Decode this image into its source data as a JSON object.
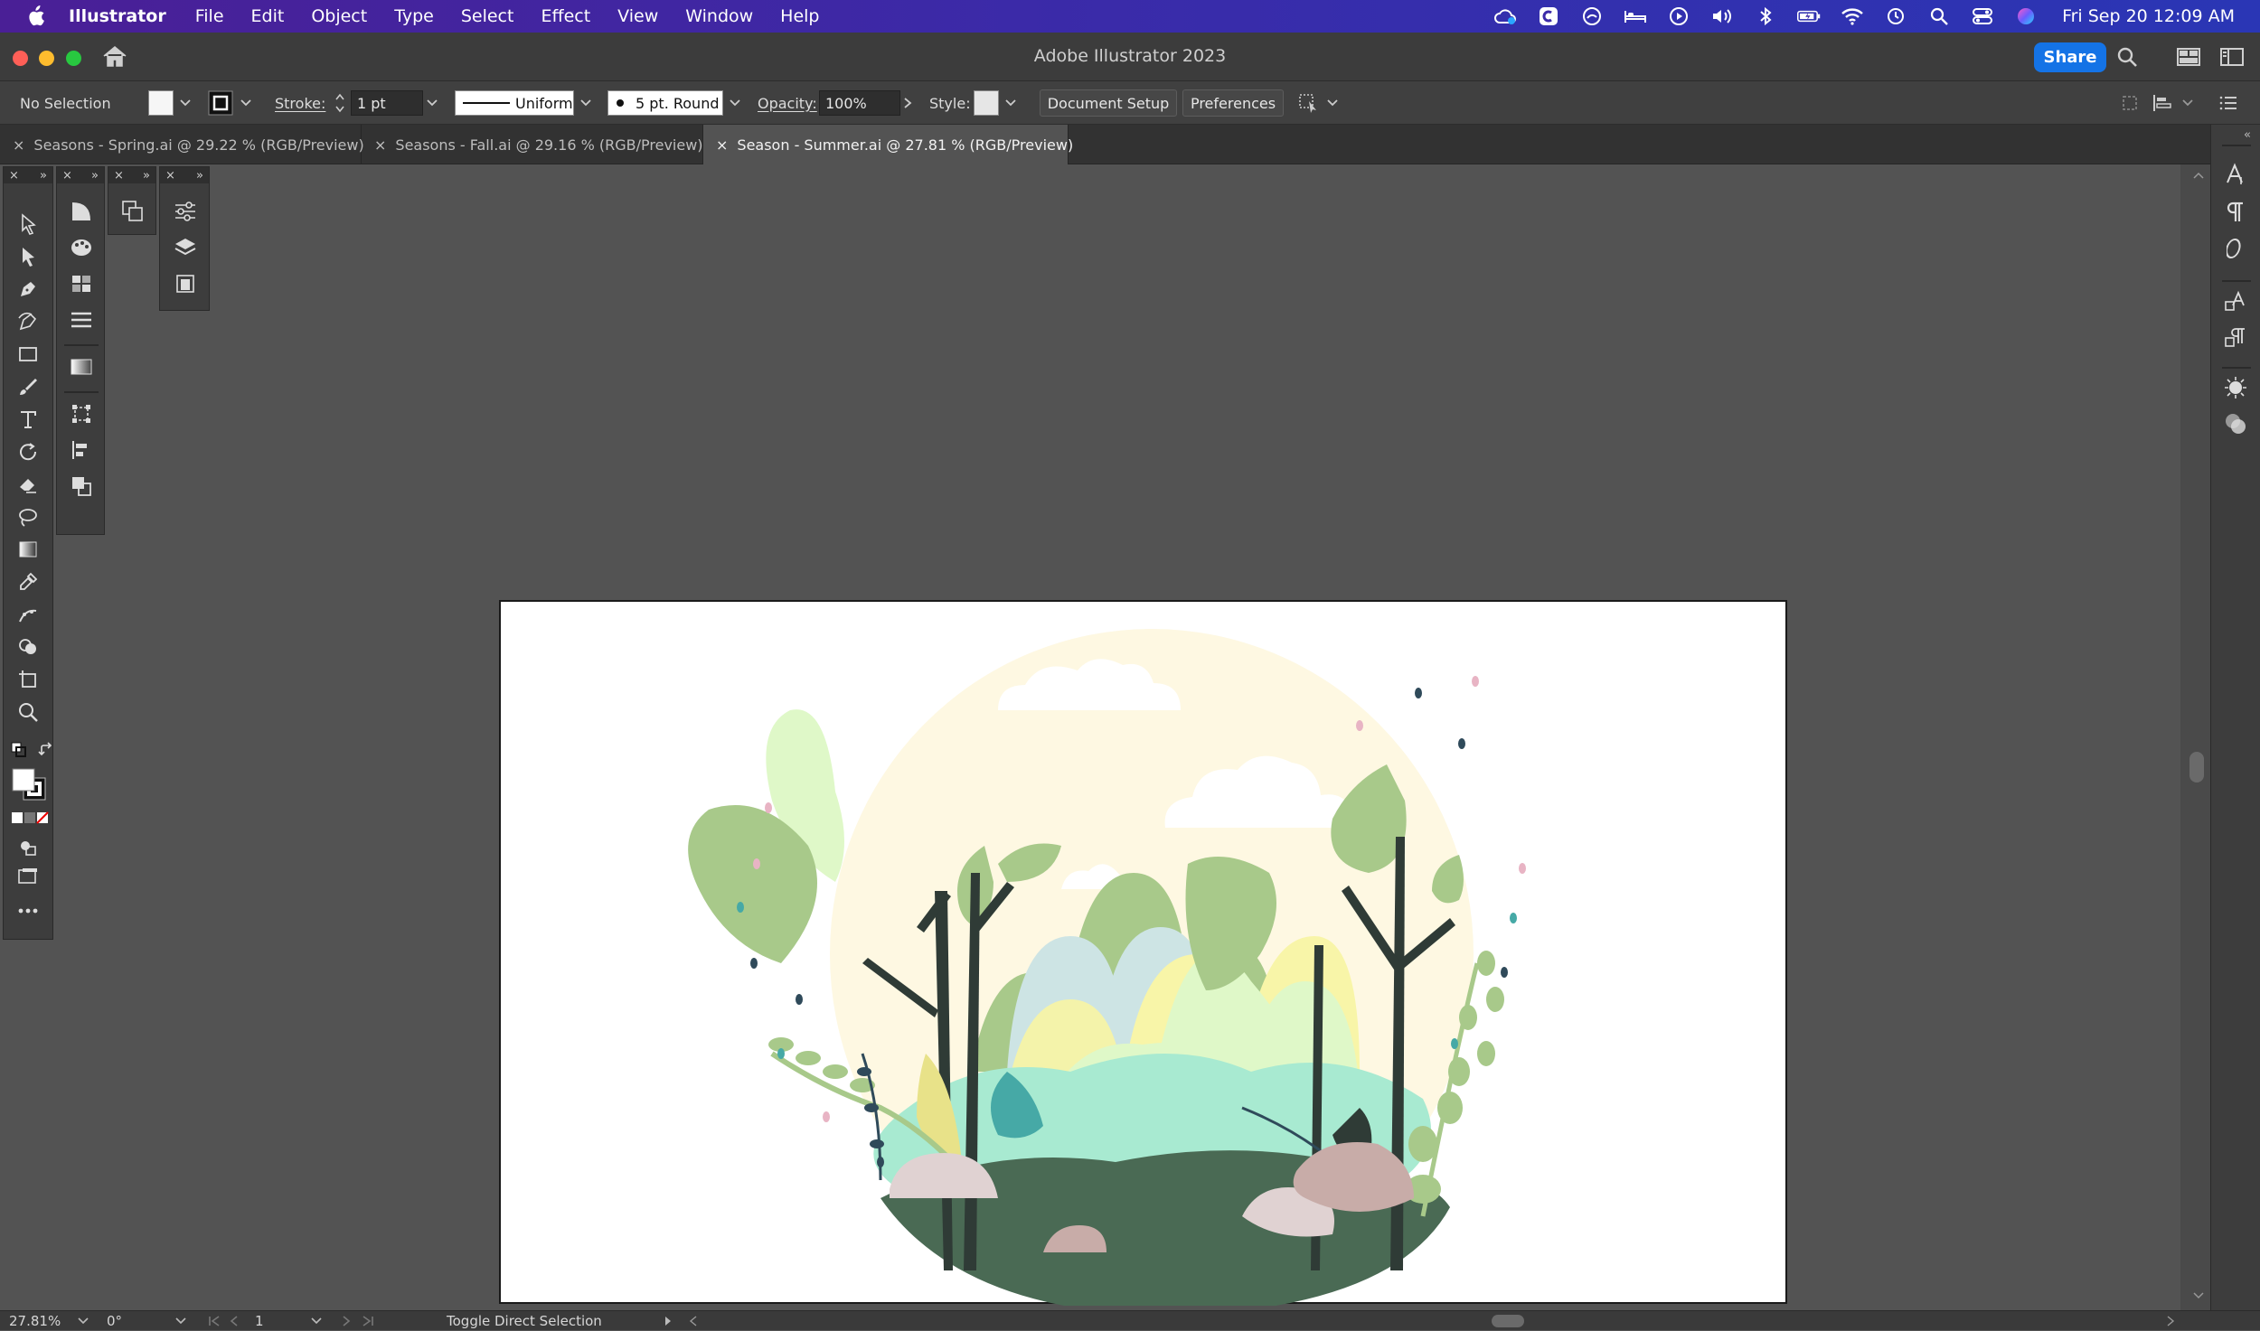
{
  "menubar": {
    "app_name": "Illustrator",
    "items": [
      "File",
      "Edit",
      "Object",
      "Type",
      "Select",
      "Effect",
      "View",
      "Window",
      "Help"
    ],
    "clock": "Fri Sep 20  12:09 AM"
  },
  "window": {
    "title": "Adobe Illustrator 2023",
    "share_label": "Share"
  },
  "control": {
    "selection": "No Selection",
    "stroke_label": "Stroke:",
    "stroke_value": "1 pt",
    "profile": "Uniform",
    "brush": "5 pt. Round",
    "opacity_label": "Opacity:",
    "opacity_value": "100%",
    "style_label": "Style:",
    "document_setup": "Document Setup",
    "preferences": "Preferences"
  },
  "tabs": [
    {
      "label": "Seasons - Spring.ai @ 29.22 % (RGB/Preview)"
    },
    {
      "label": "Seasons - Fall.ai @ 29.16 % (RGB/Preview)"
    },
    {
      "label": "Season - Summer.ai @ 27.81 % (RGB/Preview)"
    }
  ],
  "status": {
    "zoom": "27.81%",
    "rotation": "0°",
    "artboard": "1",
    "tool_hint": "Toggle Direct Selection"
  }
}
